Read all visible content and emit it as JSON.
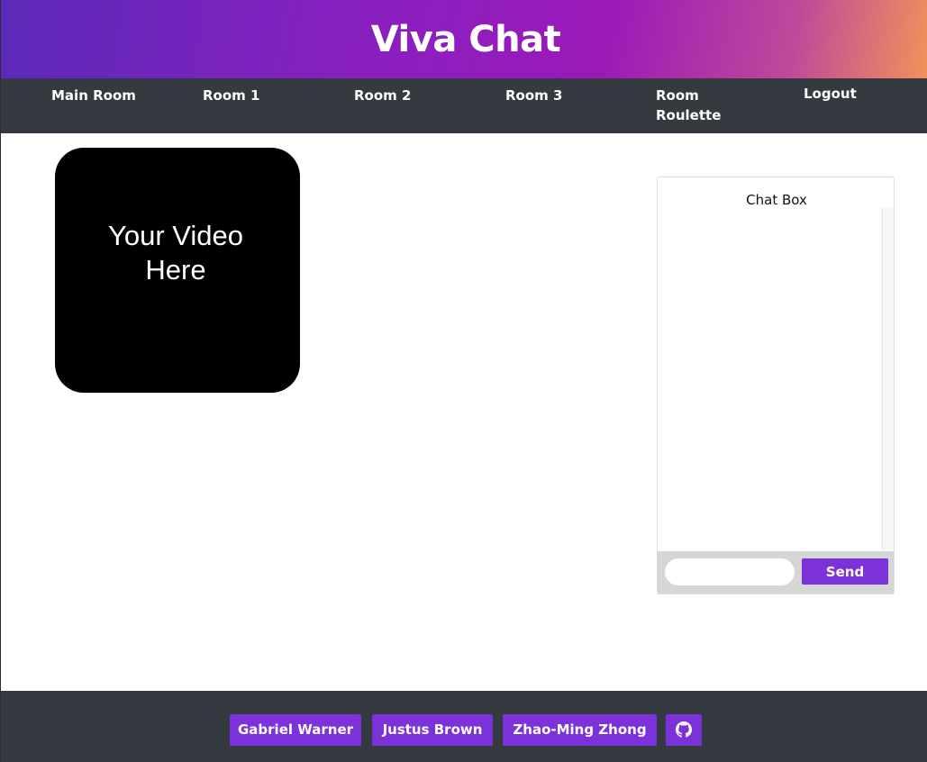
{
  "header": {
    "title": "Viva Chat"
  },
  "nav": {
    "items": [
      {
        "label": "Main Room"
      },
      {
        "label": "Room 1"
      },
      {
        "label": "Room 2"
      },
      {
        "label": "Room 3"
      },
      {
        "label": "Room Roulette"
      },
      {
        "label": "Logout"
      }
    ]
  },
  "video": {
    "placeholder_text": "Your Video Here"
  },
  "chat": {
    "title": "Chat Box",
    "input_value": "",
    "send_label": "Send"
  },
  "footer": {
    "authors": [
      {
        "name": "Gabriel Warner"
      },
      {
        "name": "Justus Brown"
      },
      {
        "name": "Zhao-Ming Zhong"
      }
    ],
    "github_icon": "github-icon"
  },
  "colors": {
    "accent": "#7b32d8",
    "nav_bg": "#343a40",
    "header_gradient_start": "#5b2ab8",
    "header_gradient_end": "#f0925a"
  }
}
